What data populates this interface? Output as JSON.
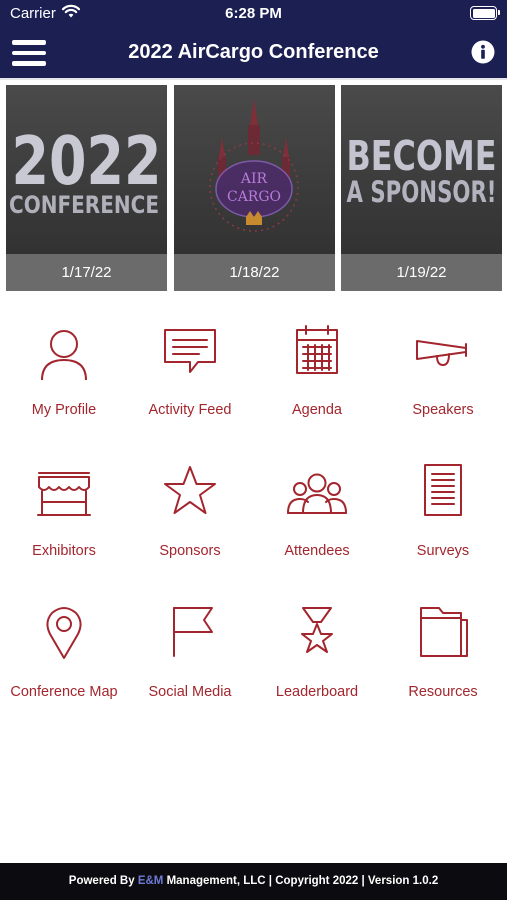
{
  "status_bar": {
    "carrier": "Carrier",
    "time": "6:28 PM"
  },
  "nav": {
    "title": "2022 AirCargo Conference",
    "menu_icon": "hamburger-menu-icon",
    "info_icon": "info-icon"
  },
  "tiles": [
    {
      "art_line1": "2022",
      "art_line2": "CONFERENCE",
      "date": "1/17/22"
    },
    {
      "art_line1": "AIR",
      "art_line2": "CARGO",
      "date": "1/18/22"
    },
    {
      "art_line1": "BECOME",
      "art_line2": "A SPONSOR!",
      "date": "1/19/22"
    }
  ],
  "menu": [
    {
      "label": "My Profile",
      "icon": "profile-icon"
    },
    {
      "label": "Activity Feed",
      "icon": "chat-bubble-icon"
    },
    {
      "label": "Agenda",
      "icon": "calendar-icon"
    },
    {
      "label": "Speakers",
      "icon": "megaphone-icon"
    },
    {
      "label": "Exhibitors",
      "icon": "storefront-icon"
    },
    {
      "label": "Sponsors",
      "icon": "star-icon"
    },
    {
      "label": "Attendees",
      "icon": "people-icon"
    },
    {
      "label": "Surveys",
      "icon": "document-icon"
    },
    {
      "label": "Conference Map",
      "icon": "map-pin-icon"
    },
    {
      "label": "Social Media",
      "icon": "flag-icon"
    },
    {
      "label": "Leaderboard",
      "icon": "medal-icon"
    },
    {
      "label": "Resources",
      "icon": "folder-icon"
    }
  ],
  "footer": {
    "prefix": "Powered By ",
    "brand": "E&M",
    "suffix": " Management, LLC | Copyright 2022 | Version 1.0.2"
  },
  "colors": {
    "nav_bg": "#1b1f52",
    "accent": "#a3262e",
    "footer_bg": "#0c0c10"
  }
}
